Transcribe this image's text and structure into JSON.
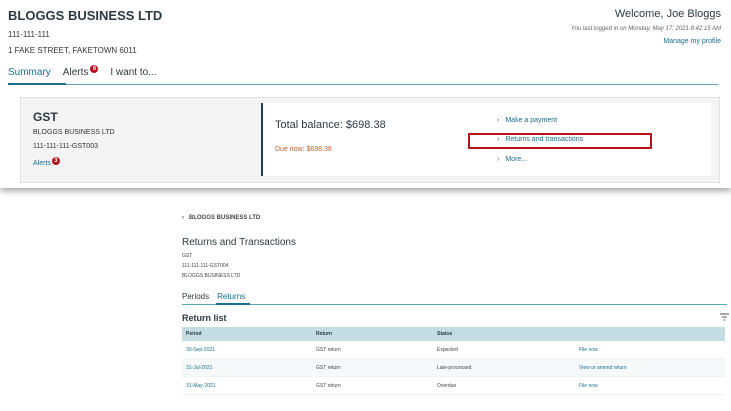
{
  "business": {
    "name": "BLOGGS BUSINESS LTD",
    "id": "111-111-111",
    "address": "1 FAKE STREET, FAKETOWN 6011"
  },
  "user": {
    "welcome": "Welcome, Joe Bloggs",
    "last_login": "You last logged in on Monday, May 17, 2021 8:42:15 AM",
    "manage_profile": "Manage my profile"
  },
  "top_tabs": [
    {
      "label": "Summary",
      "active": true
    },
    {
      "label": "Alerts",
      "badge": "6"
    },
    {
      "label": "I want to..."
    }
  ],
  "gst_card": {
    "title": "GST",
    "business": "BLOGGS BUSINESS LTD",
    "account": "111-111-111-GST003",
    "alerts_label": "Alerts",
    "alerts_badge": "3",
    "total_balance": "Total balance: $698.38",
    "due_now": "Due now: $698.38",
    "actions": [
      "Make a payment",
      "Returns and transactions",
      "More..."
    ]
  },
  "returns_page": {
    "back_label": "BLOGGS BUSINESS LTD",
    "title": "Returns and Transactions",
    "tax_type": "GST",
    "account": "111-111-111-GST004",
    "business": "BLOGGS BUSINESS LTD",
    "tabs": [
      {
        "label": "Periods"
      },
      {
        "label": "Returns",
        "active": true
      }
    ],
    "list_title": "Return list",
    "columns": [
      "Period",
      "Return",
      "Status",
      ""
    ],
    "rows": [
      {
        "period": "30-Sep-2021",
        "return": "GST return",
        "status": "Expected",
        "action": "File now"
      },
      {
        "period": "31-Jul-2021",
        "return": "GST return",
        "status": "Late-processed",
        "action": "View or amend return"
      },
      {
        "period": "31-May-2021",
        "return": "GST return",
        "status": "Overdue",
        "action": "File now"
      }
    ]
  },
  "colors": {
    "accent": "#1a6e8e",
    "alert_red": "#b5121b",
    "due_orange": "#c0612b",
    "table_header": "#c4dde3"
  }
}
